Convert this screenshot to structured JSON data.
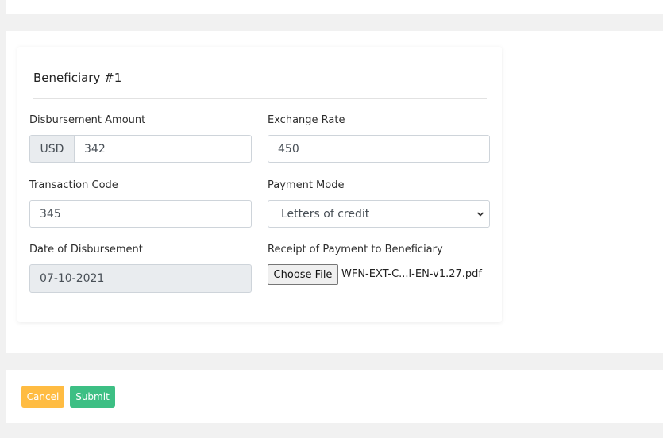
{
  "beneficiary": {
    "title": "Beneficiary #1",
    "disbursement_amount": {
      "label": "Disbursement Amount",
      "currency": "USD",
      "value": "342"
    },
    "exchange_rate": {
      "label": "Exchange Rate",
      "value": "450"
    },
    "transaction_code": {
      "label": "Transaction Code",
      "value": "345"
    },
    "payment_mode": {
      "label": "Payment Mode",
      "selected": "Letters of credit"
    },
    "date_of_disbursement": {
      "label": "Date of Disbursement",
      "value": "07-10-2021"
    },
    "receipt": {
      "label": "Receipt of Payment to Beneficiary",
      "button_label": "Choose File",
      "file_name": "WFN-EXT-C...l-EN-v1.27.pdf"
    }
  },
  "actions": {
    "cancel_label": "Cancel",
    "submit_label": "Submit"
  },
  "colors": {
    "cancel": "#ffbc42",
    "submit": "#3dbf84",
    "page_background": "#f1f1f1"
  },
  "icons": {
    "select_arrow": "chevron-down-icon"
  }
}
